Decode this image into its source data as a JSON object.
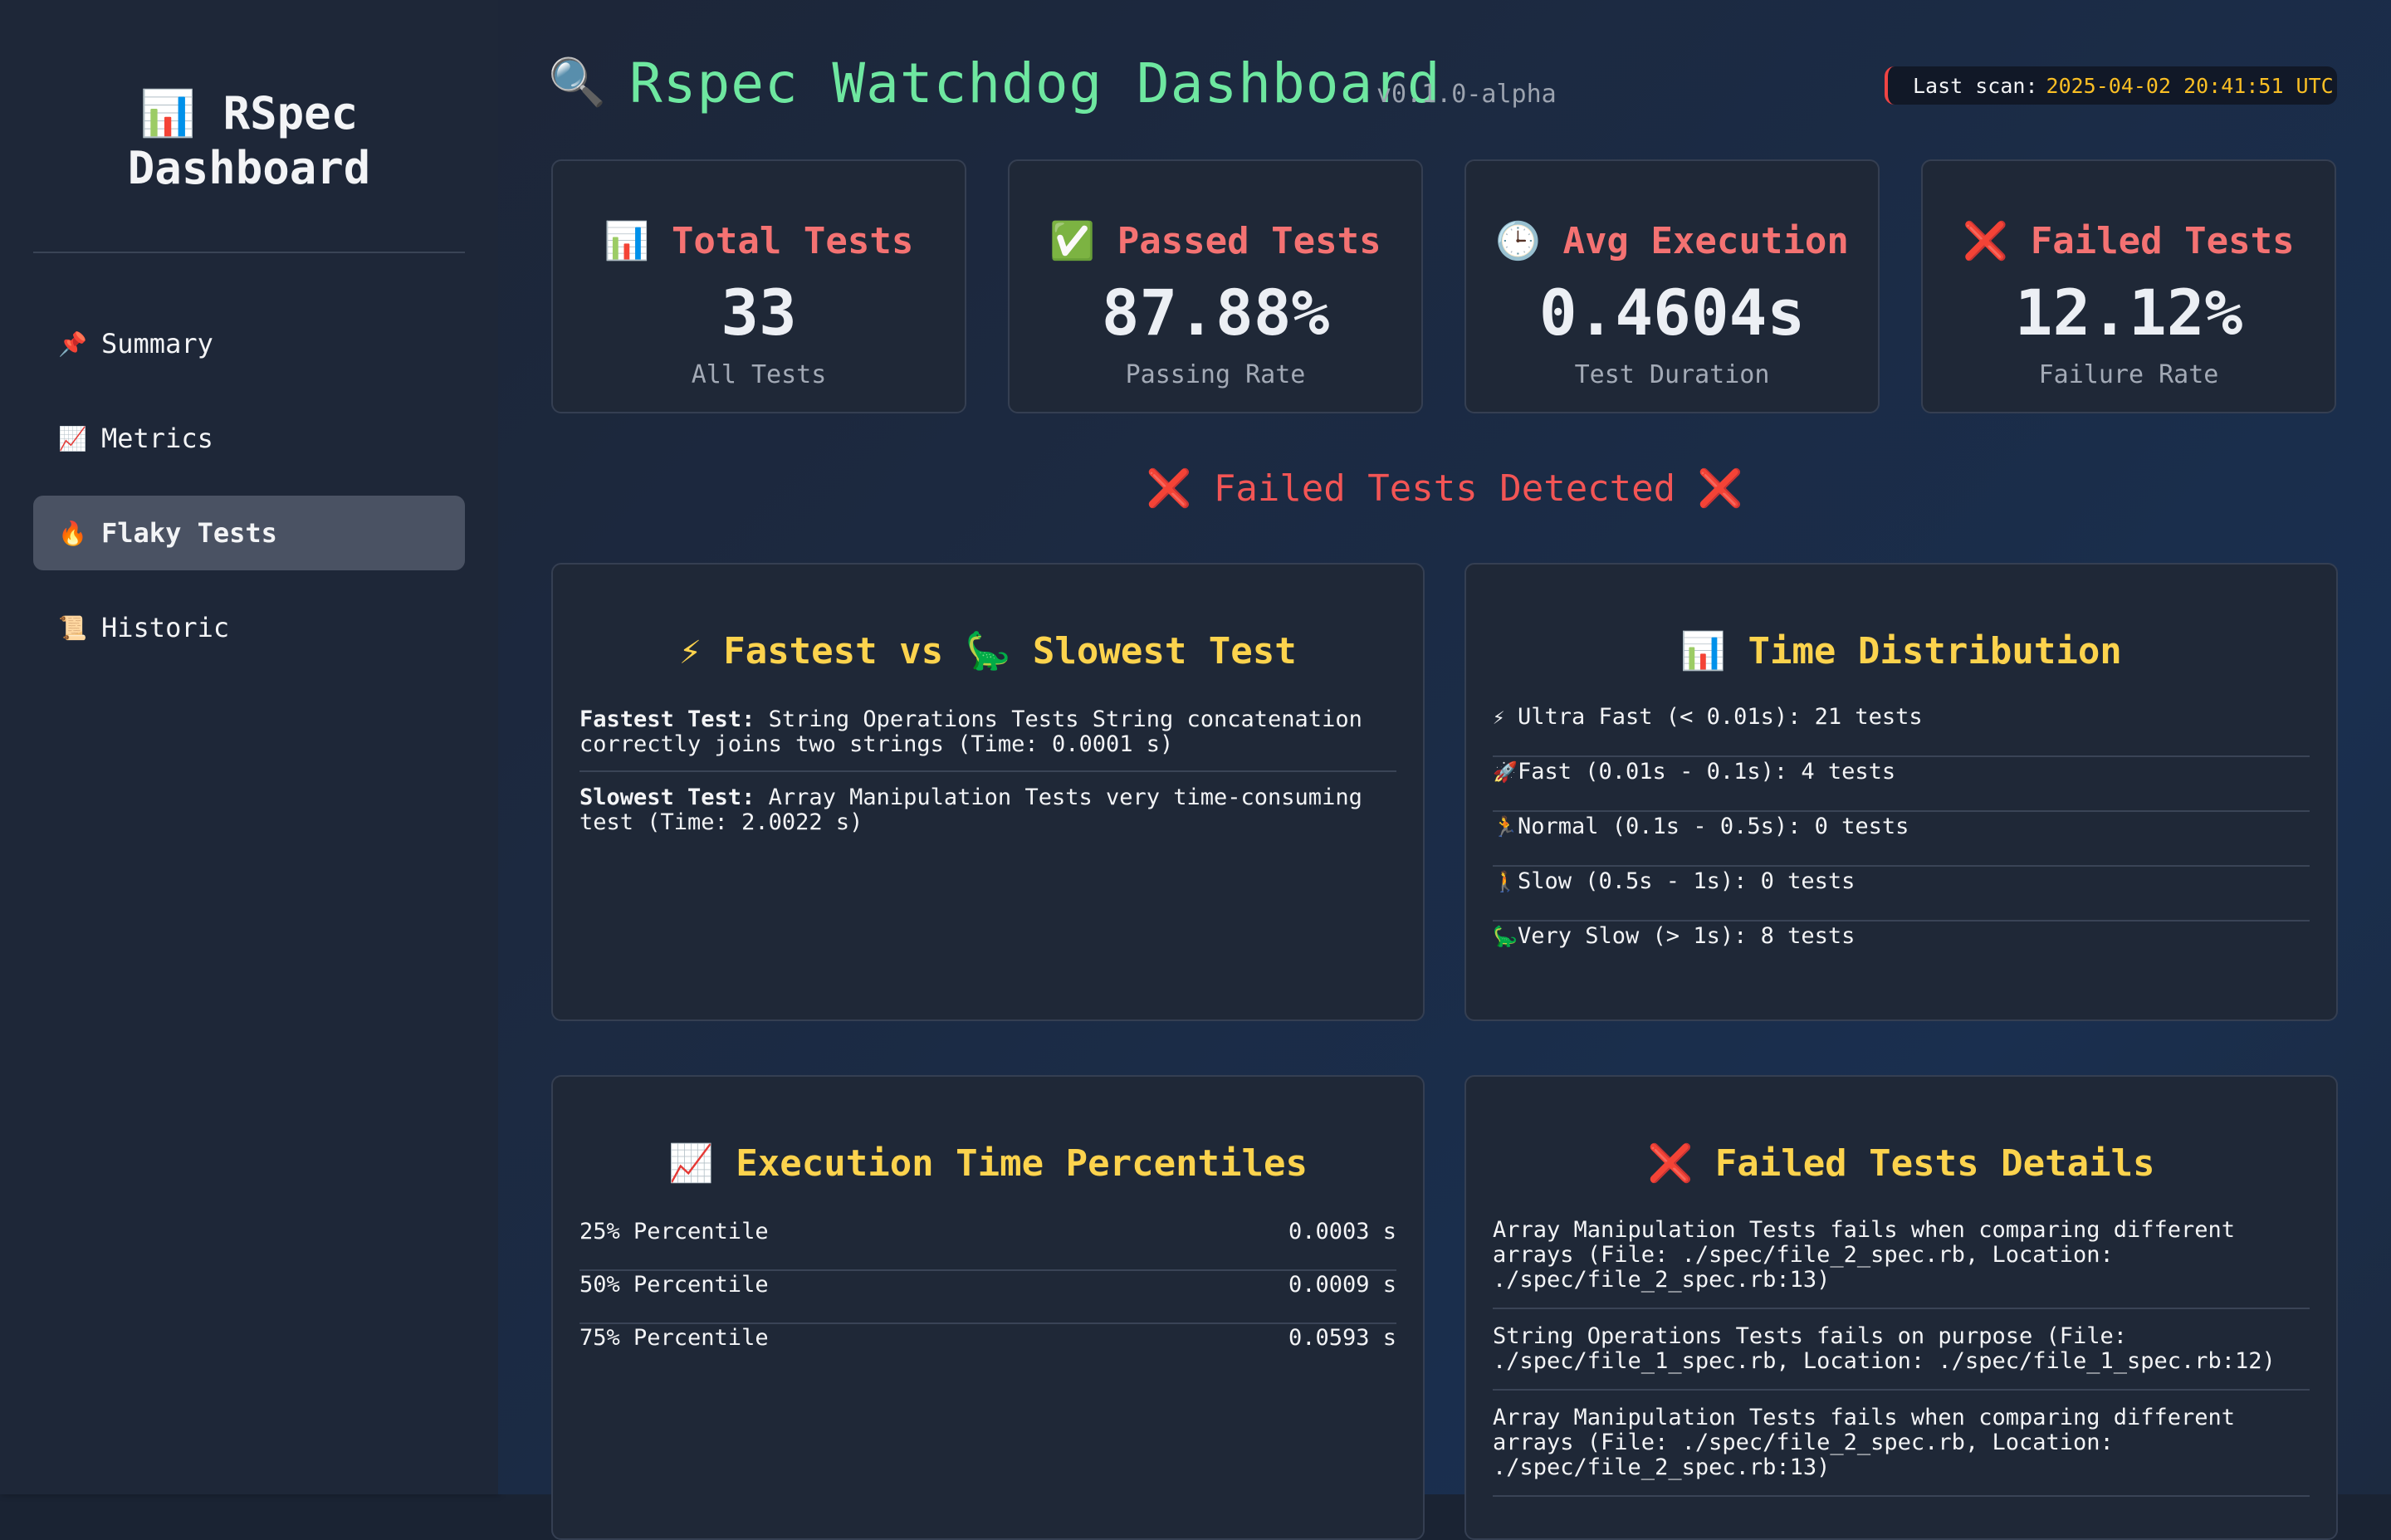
{
  "sidebar": {
    "title_line1": "📊 RSpec",
    "title_line2": "Dashboard",
    "items": [
      {
        "icon": "📌",
        "label": "Summary"
      },
      {
        "icon": "📈",
        "label": "Metrics"
      },
      {
        "icon": "🔥",
        "label": "Flaky Tests"
      },
      {
        "icon": "📜",
        "label": "Historic"
      }
    ],
    "active_item": "Flaky Tests"
  },
  "header": {
    "icon": "🔍",
    "title": "Rspec Watchdog Dashboard",
    "version": "v0.1.0-alpha",
    "scan_label": "Last scan:",
    "scan_time": "2025-04-02 20:41:51 UTC"
  },
  "stats": [
    {
      "icon": "📊",
      "title": "Total Tests",
      "value": "33",
      "label": "All Tests"
    },
    {
      "icon": "✅",
      "title": "Passed Tests",
      "value": "87.88%",
      "label": "Passing Rate"
    },
    {
      "icon": "🕒",
      "title": "Avg Execution",
      "value": "0.4604s",
      "label": "Test Duration"
    },
    {
      "icon": "❌",
      "title": "Failed Tests",
      "value": "12.12%",
      "label": "Failure Rate"
    }
  ],
  "alert": {
    "icon": "❌",
    "text": "Failed Tests Detected"
  },
  "fastest_slowest": {
    "title": "⚡ Fastest vs 🦕 Slowest Test",
    "fastest_label": "Fastest Test:",
    "fastest_text": "String Operations Tests String concatenation correctly joins two strings (Time: 0.0001 s)",
    "slowest_label": "Slowest Test:",
    "slowest_text": "Array Manipulation Tests very time-consuming test (Time: 2.0022 s)"
  },
  "time_distribution": {
    "title": "📊 Time Distribution",
    "rows": [
      {
        "icon": "⚡",
        "text": "Ultra Fast (< 0.01s): 21 tests"
      },
      {
        "icon": "🚀",
        "text": "Fast (0.01s - 0.1s): 4 tests"
      },
      {
        "icon": "🏃",
        "text": "Normal (0.1s - 0.5s): 0 tests"
      },
      {
        "icon": "🚶",
        "text": "Slow (0.5s - 1s): 0 tests"
      },
      {
        "icon": "🦕",
        "text": "Very Slow (> 1s): 8 tests"
      }
    ]
  },
  "percentiles": {
    "title": "📈 Execution Time Percentiles",
    "rows": [
      {
        "label": "25% Percentile",
        "value": "0.0003 s"
      },
      {
        "label": "50% Percentile",
        "value": "0.0009 s"
      },
      {
        "label": "75% Percentile",
        "value": "0.0593 s"
      }
    ]
  },
  "failed_details": {
    "title": "❌ Failed Tests Details",
    "rows": [
      "Array Manipulation Tests fails when comparing different arrays (File: ./spec/file_2_spec.rb, Location: ./spec/file_2_spec.rb:13)",
      "String Operations Tests fails on purpose (File: ./spec/file_1_spec.rb, Location: ./spec/file_1_spec.rb:12)",
      "Array Manipulation Tests fails when comparing different arrays (File: ./spec/file_2_spec.rb, Location: ./spec/file_2_spec.rb:13)"
    ]
  },
  "colors": {
    "accent_green": "#6ee7a0",
    "stat_title_red": "#f47272",
    "panel_title_yellow": "#fcd34d",
    "scan_time_yellow": "#fbbf24"
  }
}
